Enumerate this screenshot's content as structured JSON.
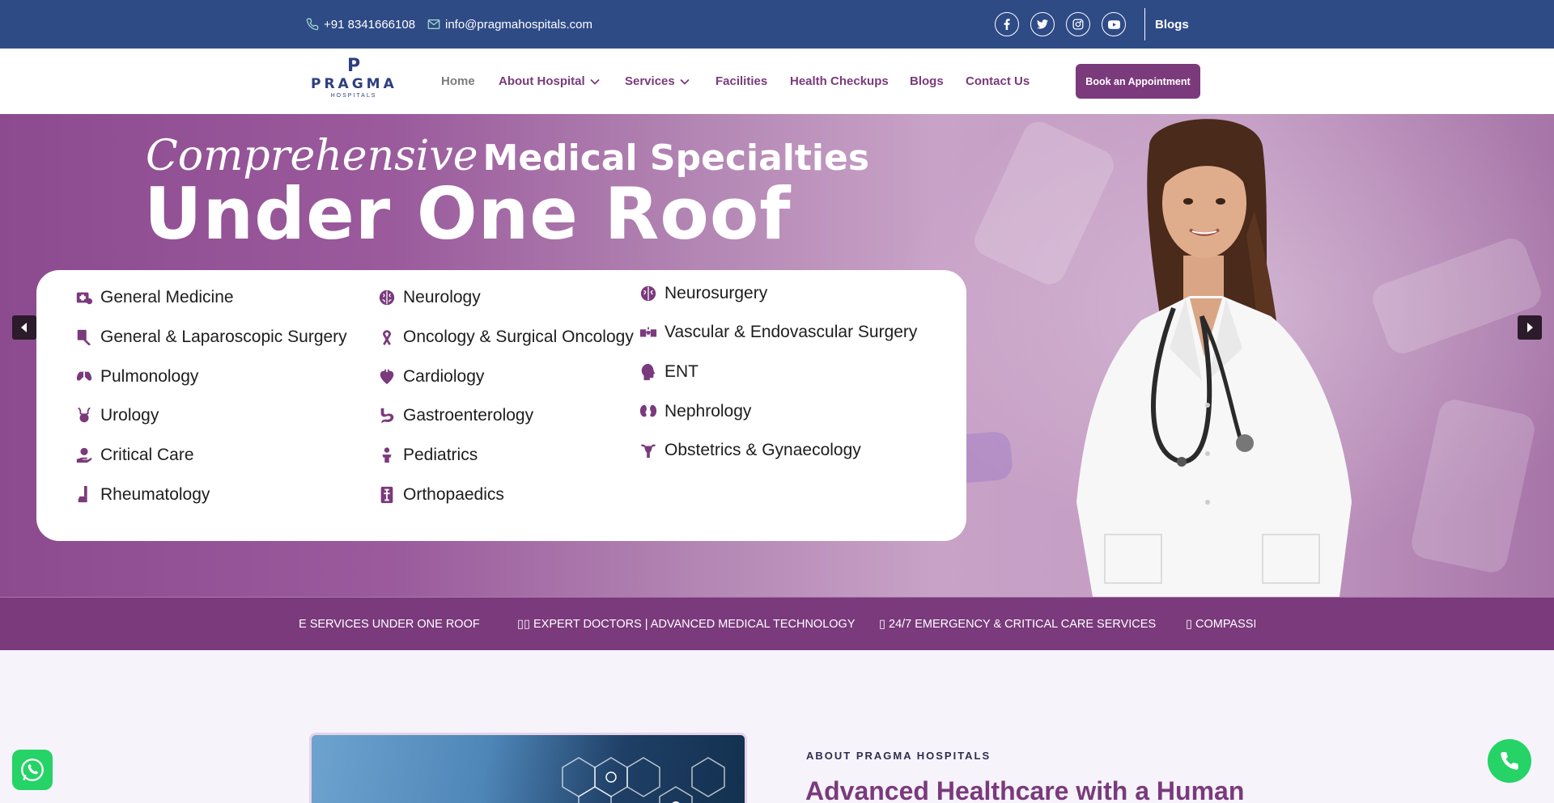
{
  "topbar": {
    "phone": "+91 8341666108",
    "email": "info@pragmahospitals.com",
    "social": [
      "facebook-icon",
      "twitter-icon",
      "instagram-icon",
      "youtube-icon"
    ],
    "blogs_label": "Blogs",
    "bg_color": "#2e4b86"
  },
  "logo": {
    "mark": "P",
    "name": "PRAGMA",
    "sub": "HOSPITALS"
  },
  "nav": {
    "items": [
      {
        "label": "Home",
        "has_dropdown": false
      },
      {
        "label": "About Hospital",
        "has_dropdown": true
      },
      {
        "label": "Services",
        "has_dropdown": true
      },
      {
        "label": "Facilities",
        "has_dropdown": false
      },
      {
        "label": "Health Checkups",
        "has_dropdown": false
      },
      {
        "label": "Blogs",
        "has_dropdown": false
      },
      {
        "label": "Contact Us",
        "has_dropdown": false
      }
    ],
    "cta_label": "Book an Appointment",
    "accent_color": "#7a3a7c"
  },
  "hero": {
    "script_text": "Comprehensive",
    "title_line1": "Medical Specialties",
    "title_line2": "Under One Roof",
    "specialties": [
      {
        "label": "General Medicine",
        "icon": "medicine-icon"
      },
      {
        "label": "General & Laparoscopic Surgery",
        "icon": "surgery-icon"
      },
      {
        "label": "Pulmonology",
        "icon": "lungs-icon"
      },
      {
        "label": "Urology",
        "icon": "kidney-bladder-icon"
      },
      {
        "label": "Critical Care",
        "icon": "care-hand-icon"
      },
      {
        "label": "Rheumatology",
        "icon": "joint-icon"
      },
      {
        "label": "Neurology",
        "icon": "brain-icon"
      },
      {
        "label": "Oncology & Surgical Oncology",
        "icon": "ribbon-icon"
      },
      {
        "label": "Cardiology",
        "icon": "heart-icon"
      },
      {
        "label": "Gastroenterology",
        "icon": "stomach-icon"
      },
      {
        "label": "Pediatrics",
        "icon": "child-icon"
      },
      {
        "label": "Orthopaedics",
        "icon": "bone-icon"
      },
      {
        "label": "Neurosurgery",
        "icon": "brain-surgery-icon"
      },
      {
        "label": "Vascular & Endovascular Surgery",
        "icon": "vascular-icon"
      },
      {
        "label": "ENT",
        "icon": "head-icon"
      },
      {
        "label": "Nephrology",
        "icon": "kidneys-icon"
      },
      {
        "label": "Obstetrics & Gynaecology",
        "icon": "uterus-icon"
      }
    ]
  },
  "ticker": {
    "items": [
      "E SERVICES UNDER ONE ROOF",
      "▯▯ EXPERT DOCTORS | ADVANCED MEDICAL TECHNOLOGY",
      "▯ 24/7 EMERGENCY & CRITICAL CARE SERVICES",
      "▯ COMPASSIC"
    ]
  },
  "about": {
    "eyebrow": "ABOUT PRAGMA HOSPITALS",
    "title": "Advanced Healthcare with a Human"
  }
}
